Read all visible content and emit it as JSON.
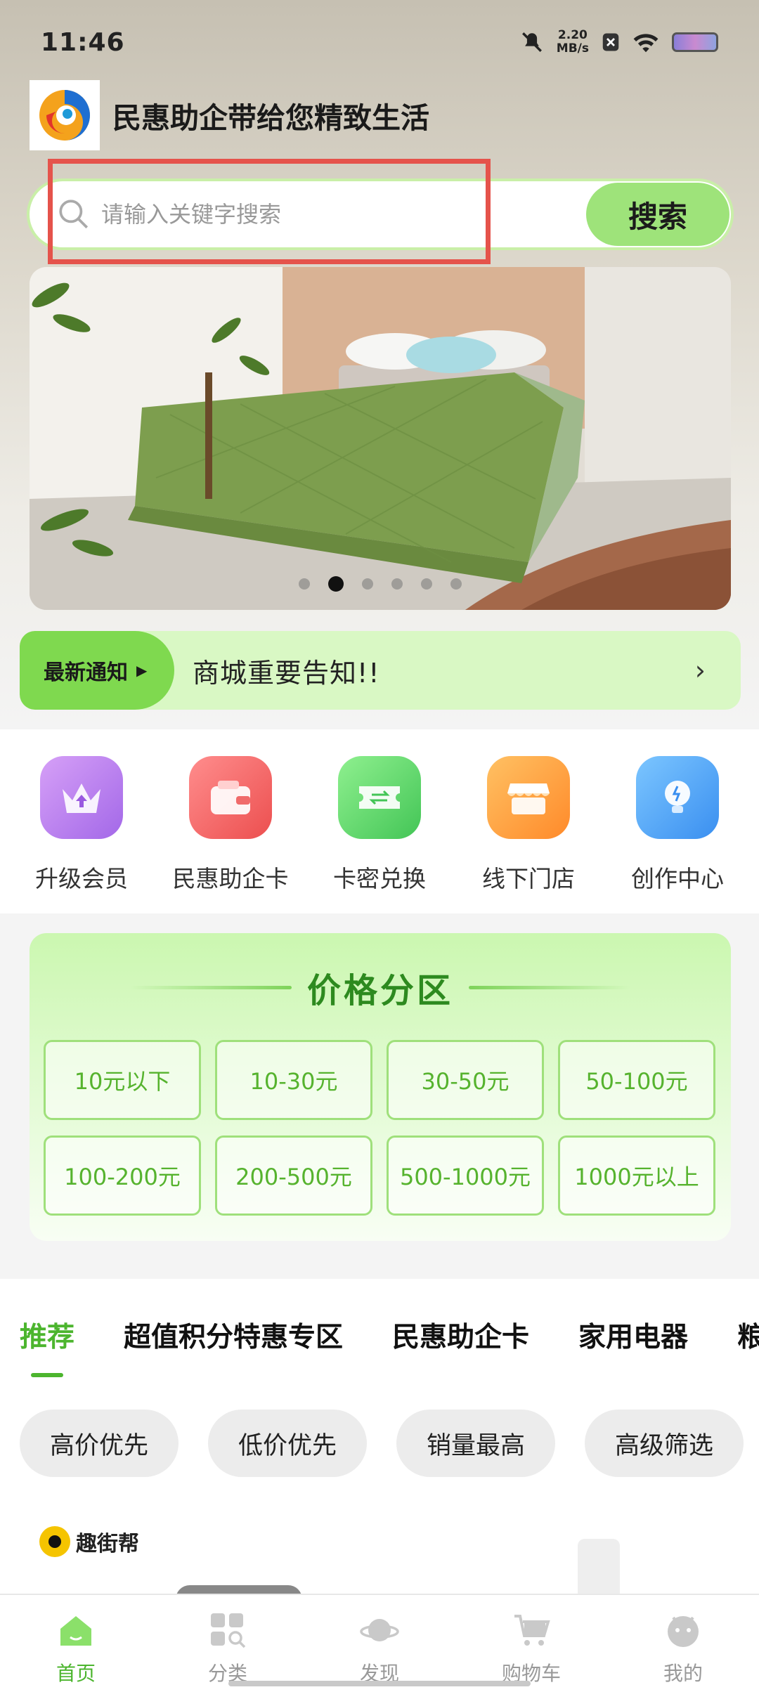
{
  "status_bar": {
    "time": "11:46",
    "net_speed_top": "2.20",
    "net_speed_unit": "MB/s"
  },
  "header": {
    "title": "民惠助企带给您精致生活"
  },
  "search": {
    "placeholder": "请输入关键字搜索",
    "button_label": "搜索"
  },
  "banner": {
    "slide_count": 6,
    "active_index": 1
  },
  "notice": {
    "tag": "最新通知",
    "text": "商城重要告知!!"
  },
  "quick_links": [
    {
      "label": "升级会员",
      "icon": "crown-upgrade-icon",
      "color": "#b87be8"
    },
    {
      "label": "民惠助企卡",
      "icon": "wallet-card-icon",
      "color": "#f36c6c"
    },
    {
      "label": "卡密兑换",
      "icon": "ticket-exchange-icon",
      "color": "#5fd36a"
    },
    {
      "label": "线下门店",
      "icon": "store-icon",
      "color": "#ff9c3a"
    },
    {
      "label": "创作中心",
      "icon": "lightbulb-icon",
      "color": "#4aa8f5"
    }
  ],
  "price_zone": {
    "title": "价格分区",
    "ranges": [
      "10元以下",
      "10-30元",
      "30-50元",
      "50-100元",
      "100-200元",
      "200-500元",
      "500-1000元",
      "1000元以上"
    ]
  },
  "tabs": [
    "推荐",
    "超值积分特惠专区",
    "民惠助企卡",
    "家用电器",
    "粮"
  ],
  "sort_options": [
    "高价优先",
    "低价优先",
    "销量最高",
    "高级筛选"
  ],
  "product_preview": {
    "brand": "趣街帮"
  },
  "bottom_nav": [
    {
      "label": "首页",
      "icon": "home-icon",
      "active": true
    },
    {
      "label": "分类",
      "icon": "category-icon",
      "active": false
    },
    {
      "label": "发现",
      "icon": "planet-discover-icon",
      "active": false
    },
    {
      "label": "购物车",
      "icon": "cart-icon",
      "active": false
    },
    {
      "label": "我的",
      "icon": "profile-face-icon",
      "active": false
    }
  ],
  "colors": {
    "accent": "#4cb52e",
    "highlight_box": "#e5534b"
  }
}
